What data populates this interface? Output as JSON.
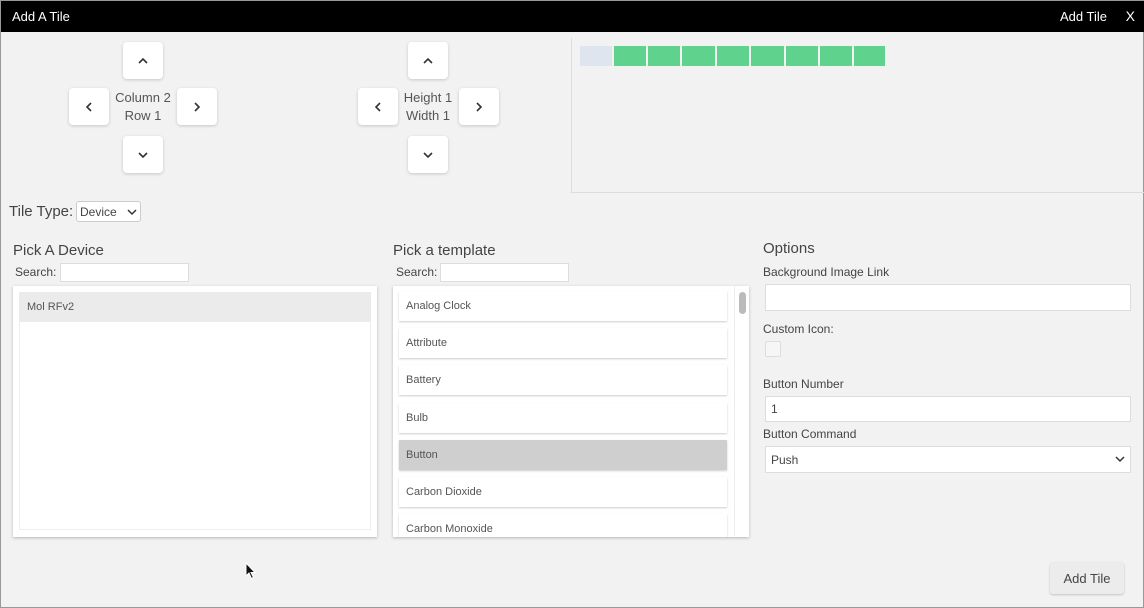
{
  "titlebar": {
    "title": "Add A Tile",
    "add_label": "Add Tile",
    "close_label": "X"
  },
  "position": {
    "column_text": "Column 2",
    "row_text": "Row 1"
  },
  "size": {
    "height_text": "Height 1",
    "width_text": "Width 1"
  },
  "grid_preview": {
    "colors": {
      "empty": "#dfe5ee",
      "filled": "#5fd38d"
    },
    "cells": [
      "empty",
      "filled",
      "filled",
      "filled",
      "filled",
      "filled",
      "filled",
      "filled",
      "filled"
    ]
  },
  "tile_type": {
    "label": "Tile Type:",
    "value": "Device"
  },
  "device_picker": {
    "title": "Pick A Device",
    "search_label": "Search:",
    "search_value": "",
    "items": [
      "Mol RFv2"
    ]
  },
  "template_picker": {
    "title": "Pick a template",
    "search_label": "Search:",
    "search_value": "",
    "items": [
      "Analog Clock",
      "Attribute",
      "Battery",
      "Bulb",
      "Button",
      "Carbon Dioxide",
      "Carbon Monoxide"
    ],
    "selected": "Button"
  },
  "options": {
    "title": "Options",
    "background_label": "Background Image Link",
    "background_value": "",
    "custom_icon_label": "Custom Icon:",
    "button_number_label": "Button Number",
    "button_number_value": "1",
    "button_command_label": "Button Command",
    "button_command_value": "Push"
  },
  "footer": {
    "add_label": "Add Tile"
  }
}
